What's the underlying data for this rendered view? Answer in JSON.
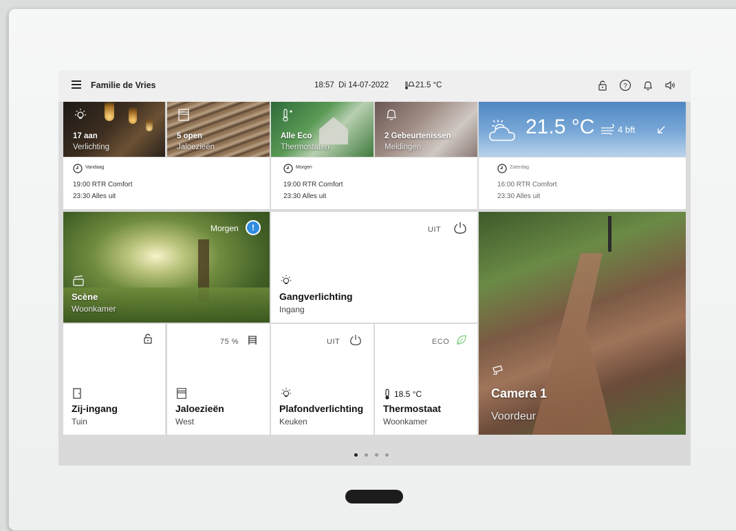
{
  "header": {
    "family_name": "Familie de Vries",
    "time": "18:57",
    "date": "Di 14-07-2022",
    "indoor_temperature": "21.5 °C"
  },
  "top_tiles": [
    {
      "title": "17 aan",
      "subtitle": "Verlichting"
    },
    {
      "title": "5 open",
      "subtitle": "Jaloezieën"
    },
    {
      "title": "Alle Eco",
      "subtitle": "Thermostaten"
    },
    {
      "title": "2 Gebeurtenissen",
      "subtitle": "Meldingen"
    }
  ],
  "weather": {
    "temperature": "21.5 °C",
    "wind": "4 bft"
  },
  "schedules": [
    {
      "day": "Vandaag",
      "lines": [
        "19:00 RTR Comfort",
        "23:30 Alles uit"
      ]
    },
    {
      "day": "Morgen",
      "lines": [
        "19:00 RTR Comfort",
        "23:30 Alles uit"
      ]
    },
    {
      "day": "Zaterdag",
      "lines": [
        "16:00 RTR Comfort",
        "23:30 Alles uit"
      ]
    }
  ],
  "scene": {
    "badge": "Morgen",
    "title": "Scène",
    "subtitle": "Woonkamer"
  },
  "hall_light": {
    "status": "UIT",
    "title": "Gangverlichting",
    "subtitle": "Ingang"
  },
  "side_door": {
    "title": "Zij-ingang",
    "subtitle": "Tuin"
  },
  "blinds": {
    "status": "75 %",
    "level_percent": 75,
    "title": "Jaloezieën",
    "subtitle": "West"
  },
  "ceiling_light": {
    "status": "UIT",
    "title": "Plafondverlichting",
    "subtitle": "Keuken"
  },
  "thermostat": {
    "status": "ECO",
    "temperature": "18.5 °C",
    "title": "Thermostaat",
    "subtitle": "Woonkamer"
  },
  "camera": {
    "title": "Camera 1",
    "subtitle": "Voordeur"
  },
  "pagination": {
    "pages": 4,
    "active_page": 1
  },
  "colors": {
    "accent_blue": "#2f8de0",
    "eco_green": "#8bd18b"
  }
}
